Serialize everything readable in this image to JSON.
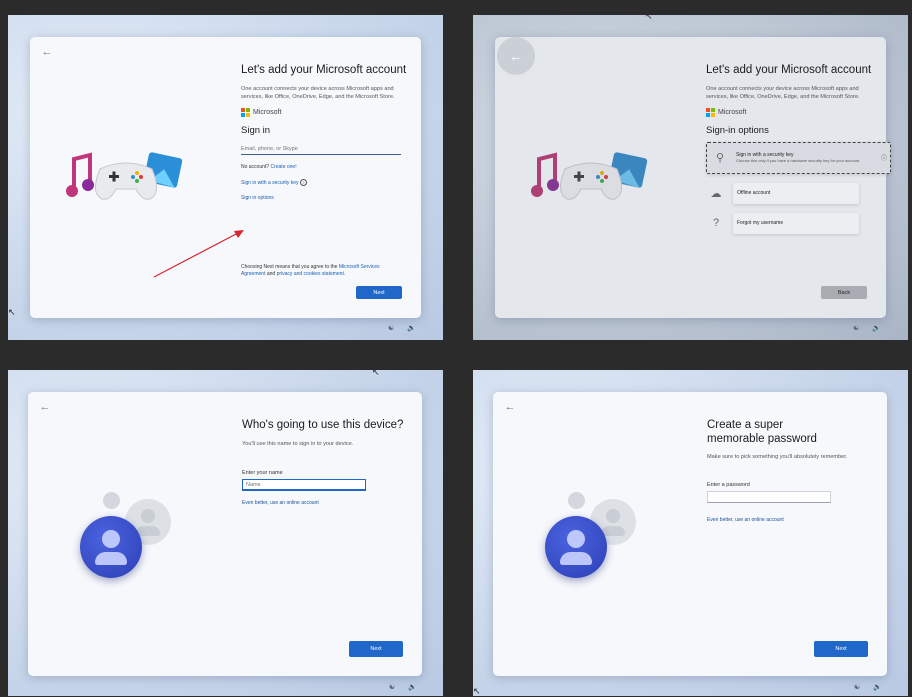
{
  "panel1": {
    "title": "Let's add your Microsoft account",
    "description": "One account connects your device across Microsoft apps and services, like Office, OneDrive, Edge, and the Microsoft Store.",
    "brand": "Microsoft",
    "heading": "Sign in",
    "input_placeholder": "Email, phone, or Skype",
    "no_account_text": "No account?",
    "create_one": "Create one!",
    "security_key_link": "Sign in with a security key",
    "sign_in_options_link": "Sign in options",
    "terms_prefix": "Choosing Next means that you agree to the",
    "terms_link": "Microsoft Services Agreement",
    "terms_mid": "and",
    "privacy_link": "privacy and cookies statement.",
    "next_button": "Next"
  },
  "panel2": {
    "title": "Let's add your Microsoft account",
    "description": "One account connects your device across Microsoft apps and services, like Office, OneDrive, Edge, and the Microsoft Store.",
    "brand": "Microsoft",
    "heading": "Sign-in options",
    "options": [
      {
        "label": "Sign in with a security key",
        "sub": "Choose this only if you have a hardware security key for your account."
      },
      {
        "label": "Offline account",
        "sub": ""
      },
      {
        "label": "Forgot my username",
        "sub": ""
      }
    ],
    "back_button": "Back"
  },
  "panel3": {
    "title": "Who's going to use this device?",
    "description": "You'll use this name to sign in to your device.",
    "field_label": "Enter your name",
    "field_placeholder": "Name",
    "online_link": "Even better, use an online account",
    "next_button": "Next"
  },
  "panel4": {
    "title": "Create a super memorable password",
    "description": "Make sure to pick something you'll absolutely remember.",
    "field_label": "Enter a password",
    "online_link": "Even better, use an online account",
    "next_button": "Next"
  }
}
